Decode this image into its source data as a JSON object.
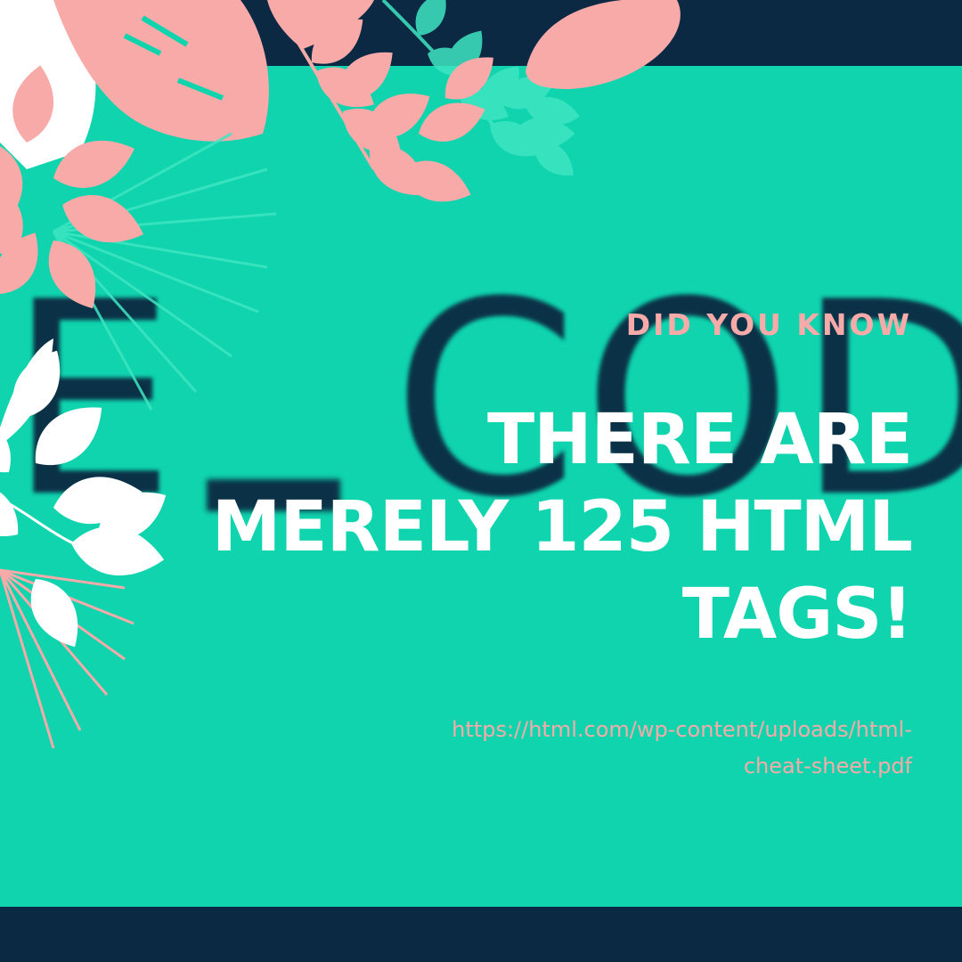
{
  "eyebrow": "DID YOU KNOW",
  "headline": [
    "THERE ARE",
    "MERELY 125 HTML",
    "TAGS!"
  ],
  "source": [
    "https://html.com/wp-content/uploads/html-",
    "cheat-sheet.pdf"
  ],
  "background_text": {
    "left": "E",
    "right": "COD"
  },
  "colors": {
    "navy": "#0b2942",
    "teal": "#0fd4ae",
    "pink": "#f7aaa8",
    "white": "#ffffff",
    "mint": "#3fe6c2"
  },
  "decorations": [
    "tropical-leaves"
  ]
}
